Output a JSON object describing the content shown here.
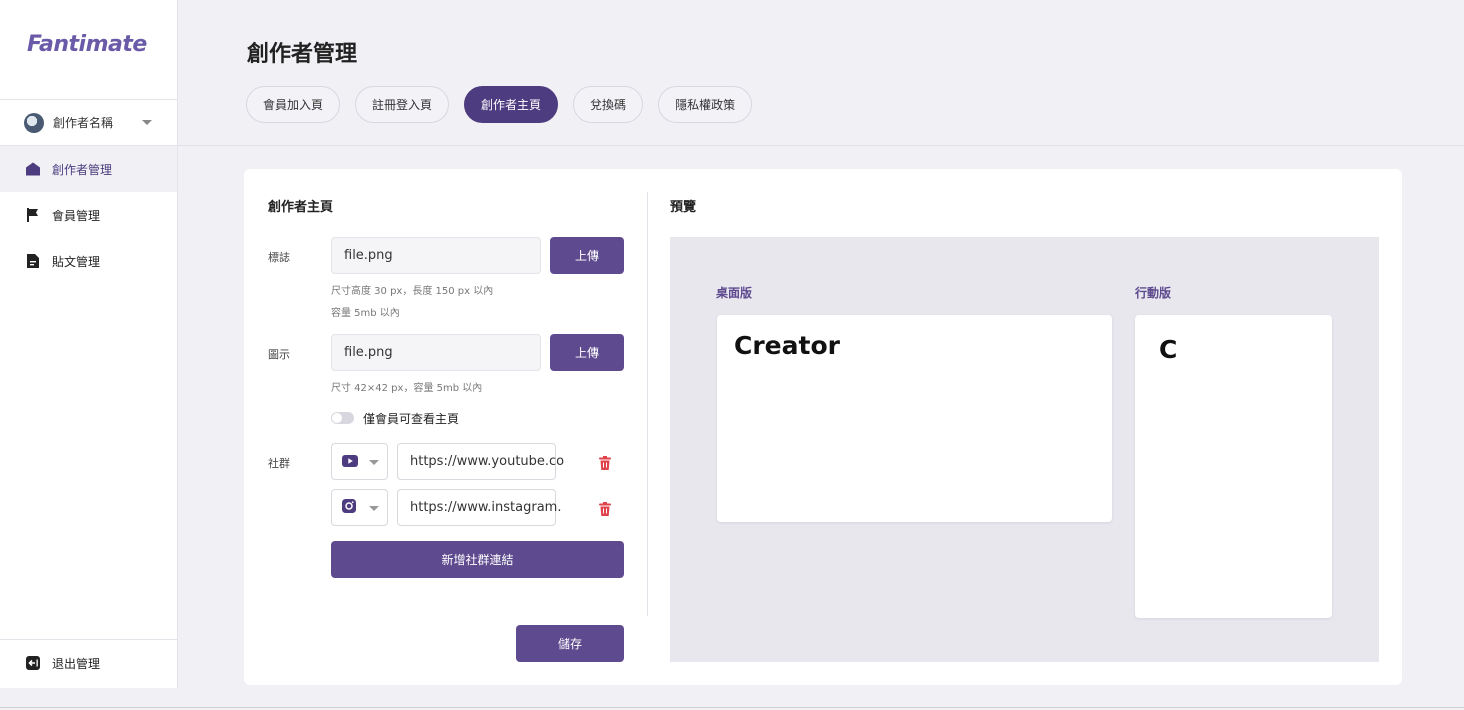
{
  "app": {
    "logo": "Fantimate"
  },
  "sidebar": {
    "creator_name": "創作者名稱",
    "items": [
      {
        "label": "創作者管理",
        "icon": "home-icon",
        "active": true
      },
      {
        "label": "會員管理",
        "icon": "flag-icon",
        "active": false
      },
      {
        "label": "貼文管理",
        "icon": "document-icon",
        "active": false
      }
    ],
    "logout": {
      "label": "退出管理",
      "icon": "logout-icon"
    }
  },
  "header": {
    "title": "創作者管理",
    "tabs": [
      {
        "label": "會員加入頁",
        "active": false
      },
      {
        "label": "註冊登入頁",
        "active": false
      },
      {
        "label": "創作者主頁",
        "active": true
      },
      {
        "label": "兌換碼",
        "active": false
      },
      {
        "label": "隱私權政策",
        "active": false
      }
    ]
  },
  "form": {
    "title": "創作者主頁",
    "logo_field": {
      "label": "標誌",
      "value": "file.png",
      "upload_label": "上傳",
      "hint1": "尺寸高度 30 px，長度 150 px 以內",
      "hint2": "容量 5mb 以內"
    },
    "icon_field": {
      "label": "圖示",
      "value": "file.png",
      "upload_label": "上傳",
      "hint": "尺寸 42×42 px，容量 5mb 以內"
    },
    "members_only_label": "僅會員可查看主頁",
    "members_only_enabled": false,
    "social": {
      "label": "社群",
      "links": [
        {
          "platform_icon": "youtube-icon",
          "url": "https://www.youtube.co"
        },
        {
          "platform_icon": "instagram-icon",
          "url": "https://www.instagram."
        }
      ],
      "add_label": "新增社群連結"
    },
    "save_label": "儲存"
  },
  "preview": {
    "title": "預覽",
    "desktop_label": "桌面版",
    "mobile_label": "行動版",
    "desktop_logo_text": "Creator",
    "mobile_logo_text": "C"
  },
  "colors": {
    "brand": "#5e4a8e",
    "brand_dark": "#4d3c7f",
    "background": "#f1f0f5",
    "danger": "#e0424b"
  }
}
